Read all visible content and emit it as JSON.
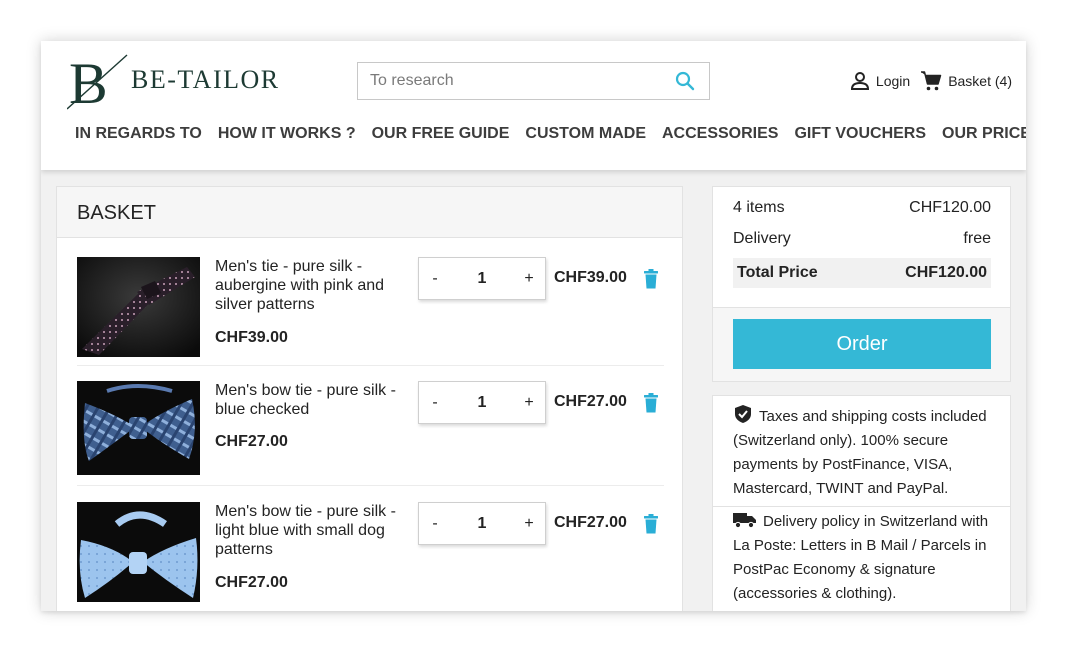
{
  "brand": {
    "name": "BE-TAILOR",
    "monogram": "B"
  },
  "search": {
    "placeholder": "To research"
  },
  "userbar": {
    "login": "Login",
    "basket": "Basket (4)"
  },
  "nav": [
    "IN REGARDS TO",
    "HOW IT WORKS ?",
    "OUR FREE GUIDE",
    "CUSTOM MADE",
    "ACCESSORIES",
    "GIFT VOUCHERS",
    "OUR PRICES"
  ],
  "cart": {
    "title": "BASKET",
    "items": [
      {
        "name": "Men's tie - pure silk - aubergine with pink and silver patterns",
        "unit_price": "CHF39.00",
        "qty": "1",
        "total": "CHF39.00"
      },
      {
        "name": "Men's bow tie - pure silk - blue checked",
        "unit_price": "CHF27.00",
        "qty": "1",
        "total": "CHF27.00"
      },
      {
        "name": "Men's bow tie - pure silk - light blue with small dog patterns",
        "unit_price": "CHF27.00",
        "qty": "1",
        "total": "CHF27.00"
      }
    ],
    "minus": "-",
    "plus": "+"
  },
  "summary": {
    "items_label": "4 items",
    "items_value": "CHF120.00",
    "delivery_label": "Delivery",
    "delivery_value": "free",
    "total_label": "Total Price",
    "total_value": "CHF120.00",
    "order_label": "Order"
  },
  "reassurance": {
    "taxes": "Taxes and shipping costs included (Switzerland only). 100% secure payments by PostFinance, VISA, Mastercard, TWINT and PayPal.",
    "delivery": "Delivery policy in Switzerland with La Poste: Letters in B Mail / Parcels in PostPac Economy & signature (accessories & clothing)."
  },
  "colors": {
    "accent": "#34b8d6",
    "brand": "#1d3a33",
    "trash": "#2aaed6"
  },
  "icons": [
    "search-icon",
    "user-icon",
    "cart-icon",
    "trash-icon",
    "shield-check-icon",
    "truck-icon"
  ]
}
